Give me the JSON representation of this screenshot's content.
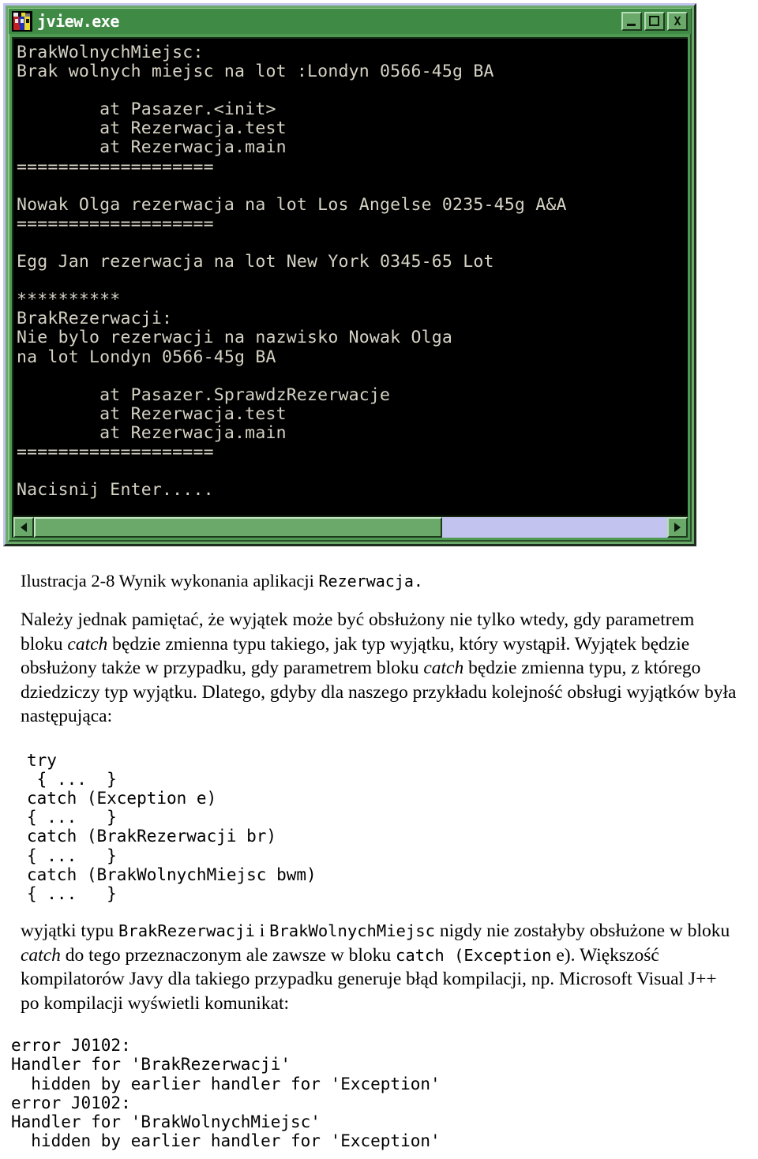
{
  "window": {
    "title": "jview.exe",
    "icon": "jview-app-icon",
    "buttons": {
      "minimize": "_",
      "maximize": "□",
      "close": "X"
    },
    "scrollbar": {
      "left_arrow": "◄",
      "right_arrow": "►",
      "thumb_position_percent": 0
    },
    "console_output": "BrakWolnychMiejsc:\nBrak wolnych miejsc na lot :Londyn 0566-45g BA\n\n        at Pasazer.<init>\n        at Rezerwacja.test\n        at Rezerwacja.main\n===================\n\nNowak Olga rezerwacja na lot Los Angelse 0235-45g A&A\n===================\n\nEgg Jan rezerwacja na lot New York 0345-65 Lot\n\n**********\nBrakRezerwacji:\nNie bylo rezerwacji na nazwisko Nowak Olga\nna lot Londyn 0566-45g BA\n\n        at Pasazer.SprawdzRezerwacje\n        at Rezerwacja.test\n        at Rezerwacja.main\n===================\n\nNacisnij Enter....."
  },
  "document": {
    "caption": {
      "text": "Ilustracja 2-8 Wynik wykonania aplikacji ",
      "mono": "Rezerwacja."
    },
    "paragraph1": {
      "seg1": "Należy jednak pamiętać, że wyjątek może być obsłużony nie tylko wtedy, gdy parametrem bloku ",
      "it1": "catch",
      "seg2": " będzie zmienna typu takiego, jak typ wyjątku, który wystąpił. Wyjątek będzie obsłużony także w przypadku, gdy parametrem bloku ",
      "it2": "catch",
      "seg3": " będzie zmienna typu, z którego dziedziczy typ wyjątku. Dlatego, gdyby dla naszego przykładu kolejność obsługi wyjątków była następująca:"
    },
    "code_block": "try\n { ...  }\ncatch (Exception e)\n{ ...   }\ncatch (BrakRezerwacji br)\n{ ...   }\ncatch (BrakWolnychMiejsc bwm)\n{ ...   }",
    "paragraph2": {
      "seg1": "wyjątki typu ",
      "mono1": "BrakRezerwacji",
      "seg2": " i ",
      "mono2": "BrakWolnychMiejsc",
      "seg3": " nigdy nie zostałyby obsłużone w bloku ",
      "it1": "catch",
      "seg4": " do tego przeznaczonym ale zawsze w bloku ",
      "mono3": "catch (Exception",
      "seg5": " e). Większość kompilatorów Javy dla takiego przypadku generuje błąd kompilacji, np. Microsoft Visual J++ po kompilacji wyświetli komunikat:"
    },
    "error_block": "error J0102:\nHandler for 'BrakRezerwacji'\n  hidden by earlier handler for 'Exception'\nerror J0102:\nHandler for 'BrakWolnychMiejsc'\n  hidden by earlier handler for 'Exception'"
  },
  "colors": {
    "window_chrome": "#4f9a53",
    "title_bar": "#3f8a45",
    "console_bg": "#000000",
    "console_fg": "#d6d2c4",
    "scrollbar_track": "#c3c3f0",
    "scrollbar_thumb": "#6aa96a",
    "page_bg": "#ffffff",
    "text": "#000000"
  }
}
